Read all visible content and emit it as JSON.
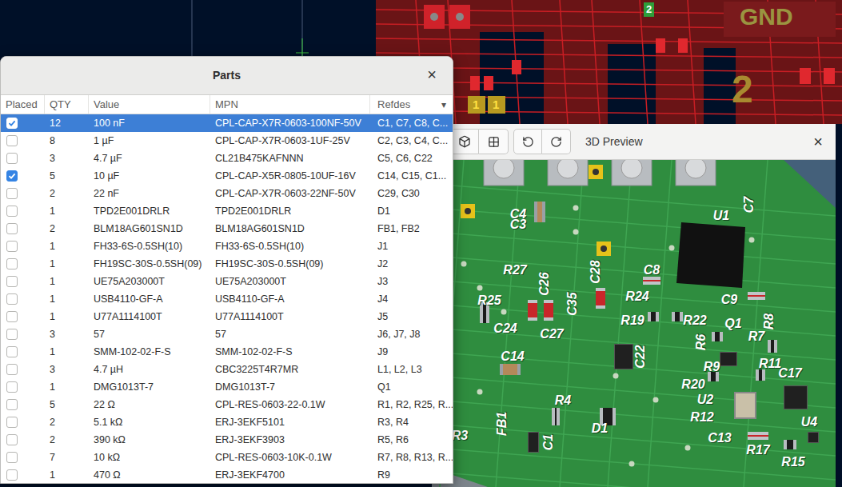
{
  "pcb_editor": {
    "labels": [
      {
        "text": "2"
      },
      {
        "text": "GND"
      },
      {
        "text": "1"
      },
      {
        "text": "1"
      },
      {
        "text": "2"
      }
    ]
  },
  "parts_dialog": {
    "title": "Parts",
    "close": "×",
    "sort_indicator": "▾",
    "columns": [
      "Placed",
      "QTY",
      "Value",
      "MPN",
      "Refdes"
    ],
    "rows": [
      {
        "placed": true,
        "selected": true,
        "qty": "12",
        "value": "100 nF",
        "mpn": "CPL-CAP-X7R-0603-100NF-50V",
        "refdes": "C1, C7, C8, C..."
      },
      {
        "placed": false,
        "selected": false,
        "qty": "8",
        "value": "1 µF",
        "mpn": "CPL-CAP-X7R-0603-1UF-25V",
        "refdes": "C2, C3, C4, C..."
      },
      {
        "placed": false,
        "selected": false,
        "qty": "3",
        "value": "4.7 µF",
        "mpn": "CL21B475KAFNNN",
        "refdes": "C5, C6, C22"
      },
      {
        "placed": true,
        "selected": false,
        "qty": "5",
        "value": "10 µF",
        "mpn": "CPL-CAP-X5R-0805-10UF-16V",
        "refdes": "C14, C15, C1..."
      },
      {
        "placed": false,
        "selected": false,
        "qty": "2",
        "value": "22 nF",
        "mpn": "CPL-CAP-X7R-0603-22NF-50V",
        "refdes": "C29, C30"
      },
      {
        "placed": false,
        "selected": false,
        "qty": "1",
        "value": "TPD2E001DRLR",
        "mpn": "TPD2E001DRLR",
        "refdes": "D1"
      },
      {
        "placed": false,
        "selected": false,
        "qty": "2",
        "value": "BLM18AG601SN1D",
        "mpn": "BLM18AG601SN1D",
        "refdes": "FB1, FB2"
      },
      {
        "placed": false,
        "selected": false,
        "qty": "1",
        "value": "FH33-6S-0.5SH(10)",
        "mpn": "FH33-6S-0.5SH(10)",
        "refdes": "J1"
      },
      {
        "placed": false,
        "selected": false,
        "qty": "1",
        "value": "FH19SC-30S-0.5SH(09)",
        "mpn": "FH19SC-30S-0.5SH(09)",
        "refdes": "J2"
      },
      {
        "placed": false,
        "selected": false,
        "qty": "1",
        "value": "UE75A203000T",
        "mpn": "UE75A203000T",
        "refdes": "J3"
      },
      {
        "placed": false,
        "selected": false,
        "qty": "1",
        "value": "USB4110-GF-A",
        "mpn": "USB4110-GF-A",
        "refdes": "J4"
      },
      {
        "placed": false,
        "selected": false,
        "qty": "1",
        "value": "U77A1114100T",
        "mpn": "U77A1114100T",
        "refdes": "J5"
      },
      {
        "placed": false,
        "selected": false,
        "qty": "3",
        "value": "57",
        "mpn": "57",
        "refdes": "J6, J7, J8"
      },
      {
        "placed": false,
        "selected": false,
        "qty": "1",
        "value": "SMM-102-02-F-S",
        "mpn": "SMM-102-02-F-S",
        "refdes": "J9"
      },
      {
        "placed": false,
        "selected": false,
        "qty": "3",
        "value": "4.7 µH",
        "mpn": "CBC3225T4R7MR",
        "refdes": "L1, L2, L3"
      },
      {
        "placed": false,
        "selected": false,
        "qty": "1",
        "value": "DMG1013T-7",
        "mpn": "DMG1013T-7",
        "refdes": "Q1"
      },
      {
        "placed": false,
        "selected": false,
        "qty": "5",
        "value": "22 Ω",
        "mpn": "CPL-RES-0603-22-0.1W",
        "refdes": "R1, R2, R25, R..."
      },
      {
        "placed": false,
        "selected": false,
        "qty": "2",
        "value": "5.1 kΩ",
        "mpn": "ERJ-3EKF5101",
        "refdes": "R3, R4"
      },
      {
        "placed": false,
        "selected": false,
        "qty": "2",
        "value": "390 kΩ",
        "mpn": "ERJ-3EKF3903",
        "refdes": "R5, R6"
      },
      {
        "placed": false,
        "selected": false,
        "qty": "7",
        "value": "10 kΩ",
        "mpn": "CPL-RES-0603-10K-0.1W",
        "refdes": "R7, R8, R13, R..."
      },
      {
        "placed": false,
        "selected": false,
        "qty": "1",
        "value": "470 Ω",
        "mpn": "ERJ-3EKF4700",
        "refdes": "R9"
      }
    ]
  },
  "preview_window": {
    "title": "3D Preview",
    "close": "×",
    "board_labels": [
      "C4",
      "C3",
      "U1",
      "C7",
      "C28",
      "R27",
      "C26",
      "C8",
      "R25",
      "C35",
      "R24",
      "C9",
      "C24",
      "C27",
      "R19",
      "R22",
      "Q1",
      "R8",
      "R6",
      "R7",
      "C14",
      "C22",
      "R9",
      "R11",
      "C17",
      "R20",
      "U2",
      "R12",
      "U4",
      "R4",
      "FB1",
      "D1",
      "C1",
      "C13",
      "R17",
      "R15",
      "R3"
    ]
  }
}
